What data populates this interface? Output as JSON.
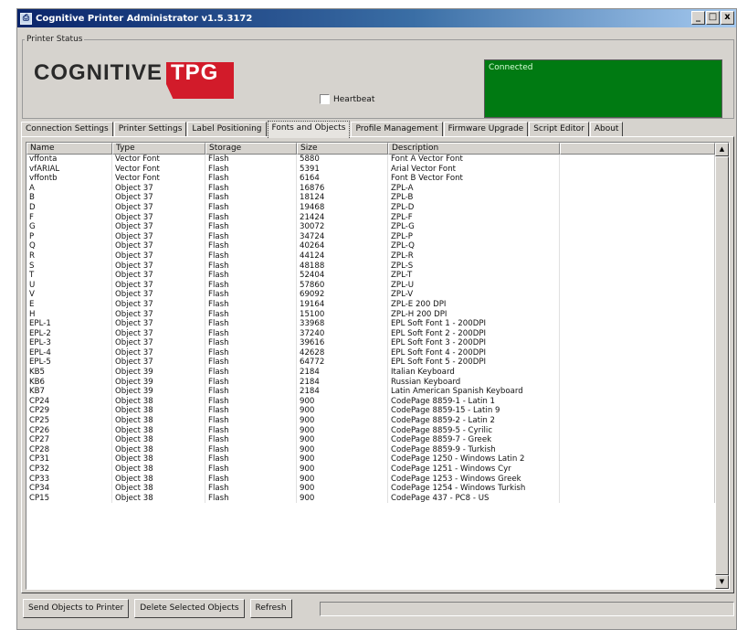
{
  "window": {
    "title": "Cognitive Printer Administrator v1.5.3172",
    "controls": {
      "minimize": "_",
      "maximize": "□",
      "close": "x"
    }
  },
  "printer_status": {
    "legend": "Printer Status",
    "logo_text": "COGNITIVE",
    "logo_accent": "TPG",
    "heartbeat_label": "Heartbeat",
    "heartbeat_checked": false,
    "status_text": "Connected",
    "status_color": "#007a12"
  },
  "tabs": [
    {
      "label": "Connection Settings"
    },
    {
      "label": "Printer Settings"
    },
    {
      "label": "Label Positioning"
    },
    {
      "label": "Fonts and Objects",
      "active": true
    },
    {
      "label": "Profile Management"
    },
    {
      "label": "Firmware Upgrade"
    },
    {
      "label": "Script Editor"
    },
    {
      "label": "About"
    }
  ],
  "table": {
    "columns": [
      "Name",
      "Type",
      "Storage",
      "Size",
      "Description",
      ""
    ],
    "rows": [
      [
        "vffonta",
        "Vector Font",
        "Flash",
        "5880",
        "Font A Vector Font"
      ],
      [
        "vfARIAL",
        "Vector Font",
        "Flash",
        "5391",
        "Arial Vector Font"
      ],
      [
        "vffontb",
        "Vector Font",
        "Flash",
        "6164",
        "Font B Vector Font"
      ],
      [
        "A",
        "Object 37",
        "Flash",
        "16876",
        "ZPL-A"
      ],
      [
        "B",
        "Object 37",
        "Flash",
        "18124",
        "ZPL-B"
      ],
      [
        "D",
        "Object 37",
        "Flash",
        "19468",
        "ZPL-D"
      ],
      [
        "F",
        "Object 37",
        "Flash",
        "21424",
        "ZPL-F"
      ],
      [
        "G",
        "Object 37",
        "Flash",
        "30072",
        "ZPL-G"
      ],
      [
        "P",
        "Object 37",
        "Flash",
        "34724",
        "ZPL-P"
      ],
      [
        "Q",
        "Object 37",
        "Flash",
        "40264",
        "ZPL-Q"
      ],
      [
        "R",
        "Object 37",
        "Flash",
        "44124",
        "ZPL-R"
      ],
      [
        "S",
        "Object 37",
        "Flash",
        "48188",
        "ZPL-S"
      ],
      [
        "T",
        "Object 37",
        "Flash",
        "52404",
        "ZPL-T"
      ],
      [
        "U",
        "Object 37",
        "Flash",
        "57860",
        "ZPL-U"
      ],
      [
        "V",
        "Object 37",
        "Flash",
        "69092",
        "ZPL-V"
      ],
      [
        "E",
        "Object 37",
        "Flash",
        "19164",
        "ZPL-E 200 DPI"
      ],
      [
        "H",
        "Object 37",
        "Flash",
        "15100",
        "ZPL-H 200 DPI"
      ],
      [
        "EPL-1",
        "Object 37",
        "Flash",
        "33968",
        "EPL Soft Font 1 - 200DPI"
      ],
      [
        "EPL-2",
        "Object 37",
        "Flash",
        "37240",
        "EPL Soft Font 2 - 200DPI"
      ],
      [
        "EPL-3",
        "Object 37",
        "Flash",
        "39616",
        "EPL Soft Font 3 - 200DPI"
      ],
      [
        "EPL-4",
        "Object 37",
        "Flash",
        "42628",
        "EPL Soft Font 4 - 200DPI"
      ],
      [
        "EPL-5",
        "Object 37",
        "Flash",
        "64772",
        "EPL Soft Font 5 - 200DPI"
      ],
      [
        "KB5",
        "Object 39",
        "Flash",
        "2184",
        "Italian Keyboard"
      ],
      [
        "KB6",
        "Object 39",
        "Flash",
        "2184",
        "Russian Keyboard"
      ],
      [
        "KB7",
        "Object 39",
        "Flash",
        "2184",
        "Latin American Spanish Keyboard"
      ],
      [
        "CP24",
        "Object 38",
        "Flash",
        "900",
        "CodePage 8859-1 - Latin 1"
      ],
      [
        "CP29",
        "Object 38",
        "Flash",
        "900",
        "CodePage 8859-15 - Latin 9"
      ],
      [
        "CP25",
        "Object 38",
        "Flash",
        "900",
        "CodePage 8859-2 - Latin 2"
      ],
      [
        "CP26",
        "Object 38",
        "Flash",
        "900",
        "CodePage 8859-5 - Cyrilic"
      ],
      [
        "CP27",
        "Object 38",
        "Flash",
        "900",
        "CodePage 8859-7 - Greek"
      ],
      [
        "CP28",
        "Object 38",
        "Flash",
        "900",
        "CodePage 8859-9 - Turkish"
      ],
      [
        "CP31",
        "Object 38",
        "Flash",
        "900",
        "CodePage 1250 - Windows Latin 2"
      ],
      [
        "CP32",
        "Object 38",
        "Flash",
        "900",
        "CodePage 1251 - Windows Cyr"
      ],
      [
        "CP33",
        "Object 38",
        "Flash",
        "900",
        "CodePage 1253 - Windows Greek"
      ],
      [
        "CP34",
        "Object 38",
        "Flash",
        "900",
        "CodePage 1254 - Windows Turkish"
      ],
      [
        "CP15",
        "Object 38",
        "Flash",
        "900",
        "CodePage 437 - PC8 - US"
      ]
    ]
  },
  "scrollbar": {
    "up_arrow": "▲",
    "down_arrow": "▼"
  },
  "buttons": {
    "send": "Send Objects to Printer",
    "delete": "Delete Selected Objects",
    "refresh": "Refresh"
  }
}
